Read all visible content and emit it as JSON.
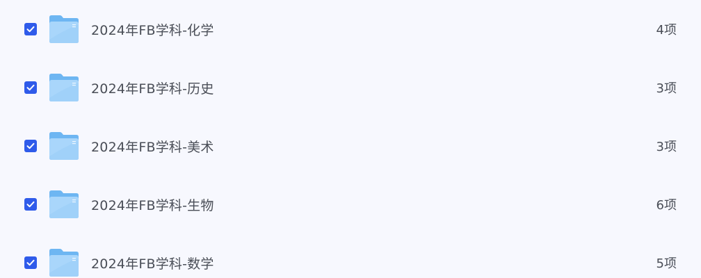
{
  "folders": [
    {
      "name": "2024年FB学科-化学",
      "count": "4项",
      "checked": true
    },
    {
      "name": "2024年FB学科-历史",
      "count": "3项",
      "checked": true
    },
    {
      "name": "2024年FB学科-美术",
      "count": "3项",
      "checked": true
    },
    {
      "name": "2024年FB学科-生物",
      "count": "6项",
      "checked": true
    },
    {
      "name": "2024年FB学科-数学",
      "count": "5项",
      "checked": true
    }
  ],
  "icons": {
    "checkbox": "checkbox-checked-icon",
    "folder": "folder-icon"
  },
  "colors": {
    "background": "#f7f8fe",
    "checkbox": "#2f5bea",
    "folder_back": "#6eb6f2",
    "folder_front": "#a9d6fb",
    "text": "#4a4e57"
  }
}
